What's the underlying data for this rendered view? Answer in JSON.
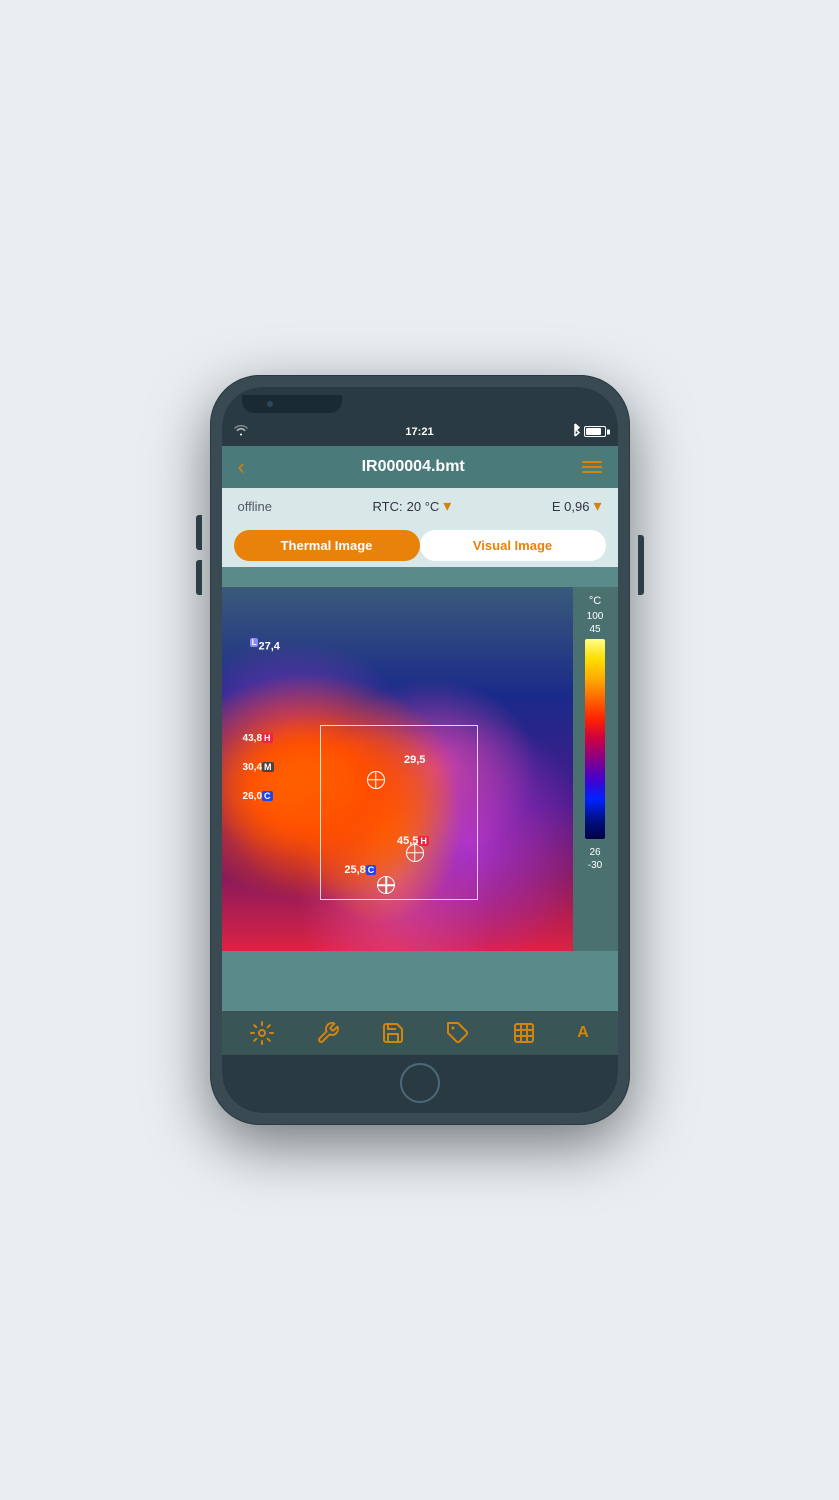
{
  "device": {
    "time": "17:21"
  },
  "header": {
    "title": "IR000004.bmt",
    "back_label": "‹",
    "menu_label": "menu"
  },
  "info_bar": {
    "offline_label": "offline",
    "rtc_label": "RTC:",
    "rtc_value": "20 °C",
    "emissivity_label": "E 0,96"
  },
  "tabs": {
    "thermal_label": "Thermal Image",
    "visual_label": "Visual Image"
  },
  "measurements": {
    "L_value": "27,4",
    "H1_value": "43,8",
    "M_value": "30,4",
    "C1_value": "26,0",
    "spot1_value": "29,5",
    "spot2_value": "45,5",
    "spot3_value": "25,8"
  },
  "scale": {
    "unit": "°C",
    "top_value": "100",
    "upper_value": "45",
    "lower_value": "26",
    "bottom_value": "-30"
  },
  "toolbar": {
    "settings_label": "settings",
    "tools_label": "tools",
    "save_label": "save",
    "tag_label": "tag",
    "export_label": "export",
    "auto_label": "A"
  }
}
